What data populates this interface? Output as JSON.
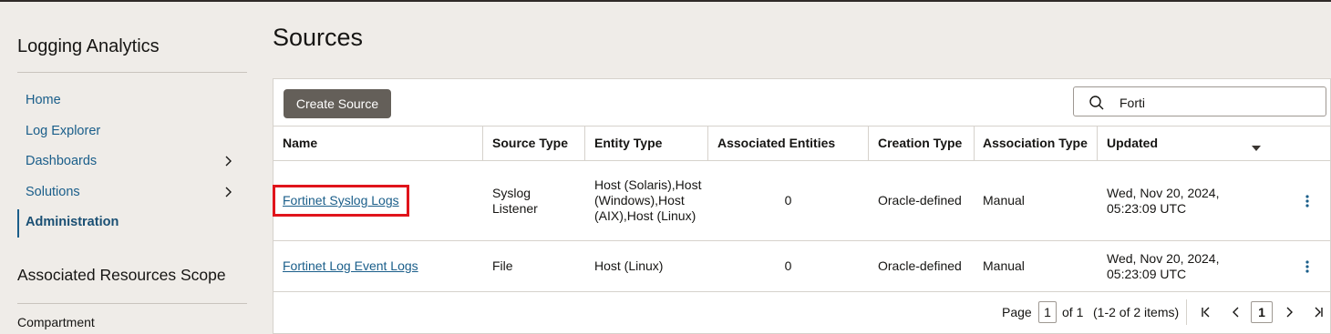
{
  "sidebar": {
    "app_title": "Logging Analytics",
    "items": [
      {
        "label": "Home"
      },
      {
        "label": "Log Explorer"
      },
      {
        "label": "Dashboards"
      },
      {
        "label": "Solutions"
      },
      {
        "label": "Administration"
      }
    ],
    "scope_title": "Associated Resources Scope",
    "compartment_label": "Compartment"
  },
  "main": {
    "title": "Sources",
    "create_button": "Create Source",
    "search_value": "Forti",
    "columns": [
      "Name",
      "Source Type",
      "Entity Type",
      "Associated Entities",
      "Creation Type",
      "Association Type",
      "Updated"
    ],
    "rows": [
      {
        "name": "Fortinet Syslog Logs",
        "source_type": "Syslog Listener",
        "entity_type": "Host (Solaris),Host (Windows),Host (AIX),Host (Linux)",
        "associated_entities": "0",
        "creation_type": "Oracle-defined",
        "association_type": "Manual",
        "updated": "Wed, Nov 20, 2024, 05:23:09 UTC"
      },
      {
        "name": "Fortinet Log Event Logs",
        "source_type": "File",
        "entity_type": "Host (Linux)",
        "associated_entities": "0",
        "creation_type": "Oracle-defined",
        "association_type": "Manual",
        "updated": "Wed, Nov 20, 2024, 05:23:09 UTC"
      }
    ],
    "pagination": {
      "page_label": "Page",
      "page_value": "1",
      "of_label": "of 1",
      "items_label": "(1-2 of 2 items)",
      "current_page": "1"
    }
  },
  "colors": {
    "link": "#1a5e8a",
    "button_bg": "#645f59",
    "highlight": "#e0141b",
    "page_bg": "#efece8"
  }
}
